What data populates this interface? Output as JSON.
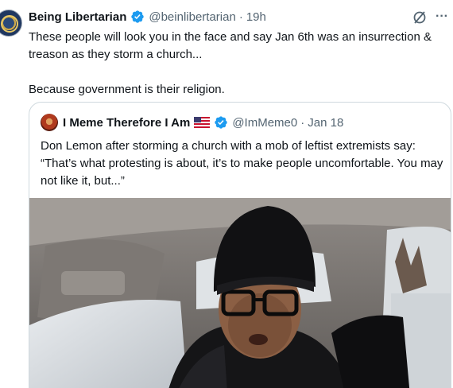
{
  "tweet": {
    "author_name": "Being Libertarian",
    "handle": "@beinlibertarian",
    "separator": "·",
    "time": "19h",
    "more_label": "···",
    "text_line1": "These people will look you in the face and say Jan 6th was an insurrection & treason as they storm a church...",
    "text_line2": "Because government is their religion."
  },
  "quote": {
    "author_name": "I Meme Therefore I Am",
    "handle": "@ImMeme0",
    "separator": "·",
    "date": "Jan 18",
    "text": "Don Lemon after storming a church with a mob of leftist extremists say: “That’s what protesting is about, it’s to make people uncomfortable. You may not like it, but...”"
  },
  "colors": {
    "verified_blue": "#1d9bf0",
    "secondary_text": "#536471",
    "border": "#cfd9de"
  },
  "icons": {
    "verified": "verified-badge-icon",
    "grok": "grok-icon",
    "more": "more-icon",
    "flag": "us-flag-icon"
  }
}
